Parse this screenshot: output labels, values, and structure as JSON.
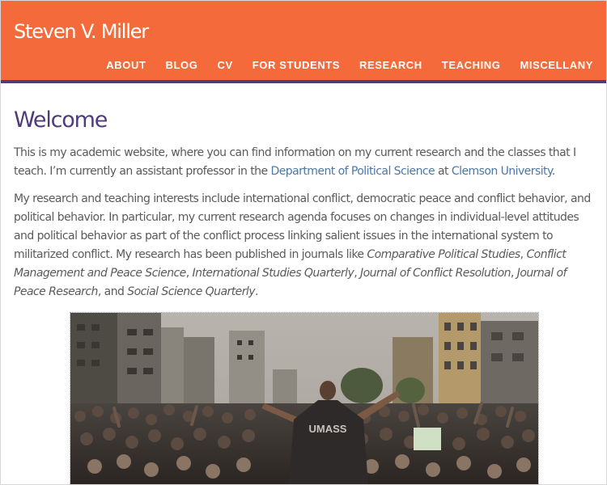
{
  "header": {
    "site_title": "Steven V. Miller",
    "nav": [
      "ABOUT",
      "BLOG",
      "CV",
      "FOR STUDENTS",
      "RESEARCH",
      "TEACHING",
      "MISCELLANY"
    ]
  },
  "colors": {
    "header_bg": "#f46a3b",
    "header_rule": "#4f3a7a",
    "heading": "#4f3a7a",
    "link": "#4a78a8",
    "body_text": "#5a5a5a"
  },
  "main": {
    "title": "Welcome",
    "intro": {
      "t1": "This is my academic website, where you can find information on my current research and the classes that I teach. I’m currently an assistant professor in the ",
      "link1": "Department of Political Science",
      "t2": " at ",
      "link2": "Clemson University",
      "t3": "."
    },
    "research": {
      "t1": "My research and teaching interests include international conflict, democratic peace and conflict behavior, and political behavior. In particular, my current research agenda focuses on changes in individual-level attitudes and political behavior as part of the conflict process linking salient issues in the international system to militarized conflict. My research has been published in journals like ",
      "j1": "Comparative Political Studies",
      "s1": ", ",
      "j2": "Conflict Management and Peace Science",
      "s2": ", ",
      "j3": "International Studies Quarterly",
      "s3": ", ",
      "j4": "Journal of Conflict Resolution",
      "s4": ", ",
      "j5": "Journal of Peace Research",
      "s5": ", and ",
      "j6": "Social Science Quarterly",
      "s6": "."
    },
    "photo": {
      "shirt_text": "UMASS"
    }
  }
}
